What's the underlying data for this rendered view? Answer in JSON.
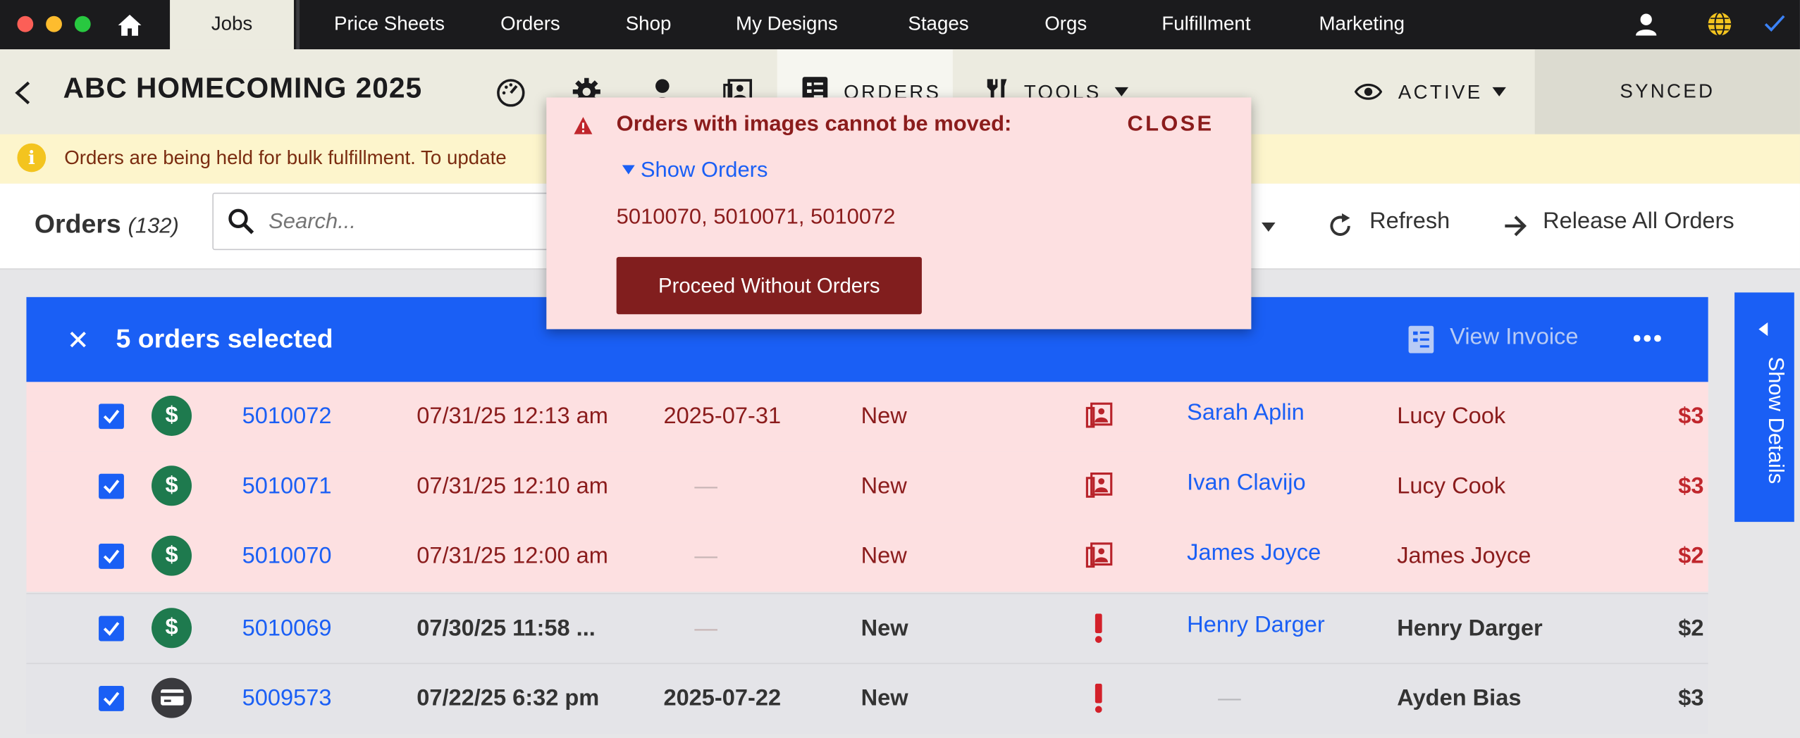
{
  "nav": {
    "tabs": [
      "Jobs",
      "Price Sheets",
      "Orders",
      "Shop",
      "My Designs",
      "Stages",
      "Orgs",
      "Fulfillment",
      "Marketing"
    ],
    "active_tab": "Jobs"
  },
  "header": {
    "title": "ABC HOMECOMING 2025",
    "orders_label": "ORDERS",
    "tools_label": "TOOLS",
    "status_label": "ACTIVE",
    "sync_label": "SYNCED"
  },
  "notice": {
    "text": "Orders are being held for bulk fulfillment. To update"
  },
  "toolbar": {
    "heading": "Orders",
    "count": "(132)",
    "search_placeholder": "Search...",
    "refresh_label": "Refresh",
    "release_label": "Release All Orders"
  },
  "selection": {
    "text": "5 orders selected",
    "view_invoice_label": "View Invoice"
  },
  "rows": [
    {
      "id": "5010072",
      "created": "07/31/25 12:13 am",
      "date": "2025-07-31",
      "status": "New",
      "customer": "Sarah Aplin",
      "recipient": "Lucy Cook",
      "amount": "$3",
      "state": "error",
      "pay": "dollar-icon",
      "flag": "images-icon"
    },
    {
      "id": "5010071",
      "created": "07/31/25 12:10 am",
      "date": "—",
      "status": "New",
      "customer": "Ivan Clavijo",
      "recipient": "Lucy Cook",
      "amount": "$3",
      "state": "error",
      "pay": "dollar-icon",
      "flag": "images-icon"
    },
    {
      "id": "5010070",
      "created": "07/31/25 12:00 am",
      "date": "—",
      "status": "New",
      "customer": "James Joyce",
      "recipient": "James Joyce",
      "amount": "$2",
      "state": "error",
      "pay": "dollar-icon",
      "flag": "images-icon"
    },
    {
      "id": "5010069",
      "created": "07/30/25 11:58 ...",
      "date": "—",
      "status": "New",
      "customer": "Henry Darger",
      "recipient": "Henry Darger",
      "amount": "$2",
      "state": "normal",
      "pay": "dollar-icon",
      "flag": "exclamation-icon"
    },
    {
      "id": "5009573",
      "created": "07/22/25 6:32 pm",
      "date": "2025-07-22",
      "status": "New",
      "customer": "—",
      "recipient": "Ayden Bias",
      "amount": "$3",
      "state": "normal",
      "pay": "card-icon",
      "flag": "exclamation-icon"
    }
  ],
  "side_panel": {
    "label": "Show Details"
  },
  "popup": {
    "title": "Orders with images cannot be moved:",
    "close_label": "CLOSE",
    "toggle_label": "Show Orders",
    "orders_list": "5010070, 5010071, 5010072",
    "proceed_label": "Proceed Without Orders"
  },
  "colors": {
    "accent": "#1a5ff5",
    "error_bg": "#fde0e1",
    "error_text": "#8b1c1c",
    "proceed_bg": "#811e1e",
    "money_badge": "#1e7a4e",
    "card_badge": "#3a3a3e",
    "notice_bg": "#fdf5cc"
  }
}
